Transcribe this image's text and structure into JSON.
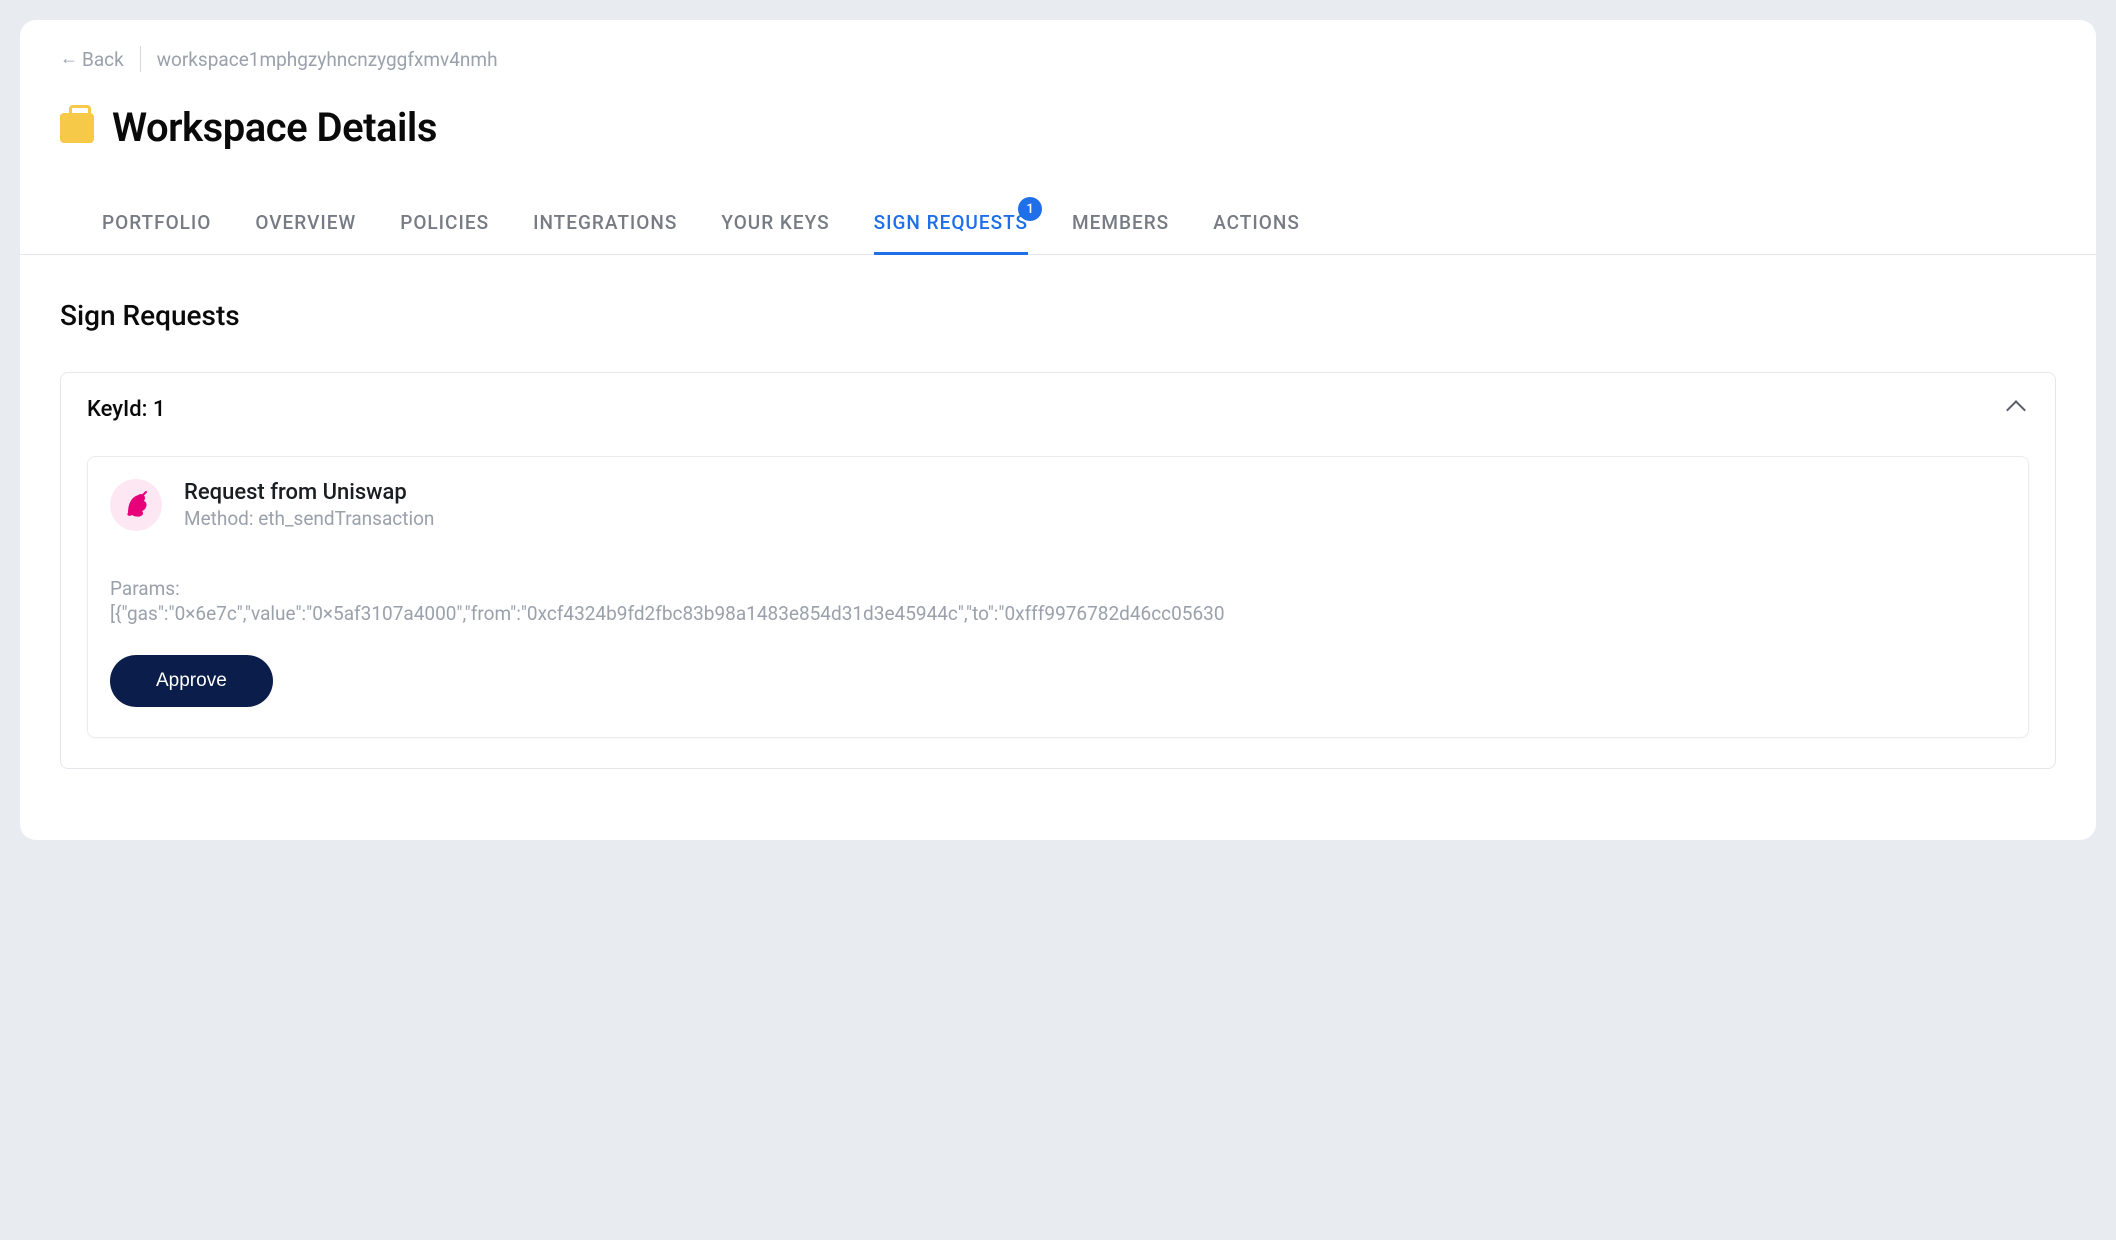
{
  "nav": {
    "back_label": "Back",
    "breadcrumb": "workspace1mphgzyhncnzyggfxmv4nmh"
  },
  "header": {
    "title": "Workspace Details"
  },
  "tabs": {
    "items": [
      {
        "label": "PORTFOLIO"
      },
      {
        "label": "OVERVIEW"
      },
      {
        "label": "POLICIES"
      },
      {
        "label": "INTEGRATIONS"
      },
      {
        "label": "YOUR KEYS"
      },
      {
        "label": "SIGN REQUESTS",
        "badge": "1",
        "active": true
      },
      {
        "label": "MEMBERS"
      },
      {
        "label": "ACTIONS"
      }
    ]
  },
  "section": {
    "title": "Sign Requests"
  },
  "panel": {
    "title": "KeyId: 1",
    "request": {
      "dapp_icon": "uniswap-icon",
      "title": "Request from Uniswap",
      "method_label": "Method: eth_sendTransaction",
      "params_label": "Params:",
      "params_value": "[{\"gas\":\"0×6e7c\",\"value\":\"0×5af3107a4000\",\"from\":\"0xcf4324b9fd2fbc83b98a1483e854d31d3e45944c\",\"to\":\"0xfff9976782d46cc05630",
      "approve_label": "Approve"
    }
  }
}
